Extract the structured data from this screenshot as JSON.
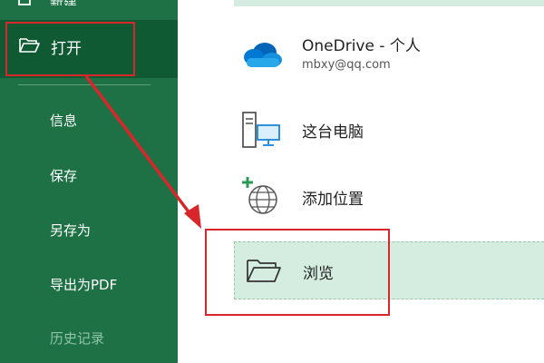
{
  "sidebar": {
    "top_label": "新建",
    "open_label": "打开",
    "items": [
      {
        "label": "信息"
      },
      {
        "label": "保存"
      },
      {
        "label": "另存为"
      },
      {
        "label": "导出为PDF"
      },
      {
        "label": "历史记录"
      }
    ]
  },
  "locations": {
    "onedrive": {
      "title": "OneDrive - 个人",
      "account": "mbxy@qq.com"
    },
    "this_pc": {
      "title": "这台电脑"
    },
    "add_place": {
      "title": "添加位置"
    },
    "browse": {
      "title": "浏览"
    }
  },
  "colors": {
    "sidebar_bg": "#1e7145",
    "sidebar_selected": "#0f5a33",
    "highlight_bg": "#d5ede0",
    "annotation_red": "#d9262a"
  }
}
